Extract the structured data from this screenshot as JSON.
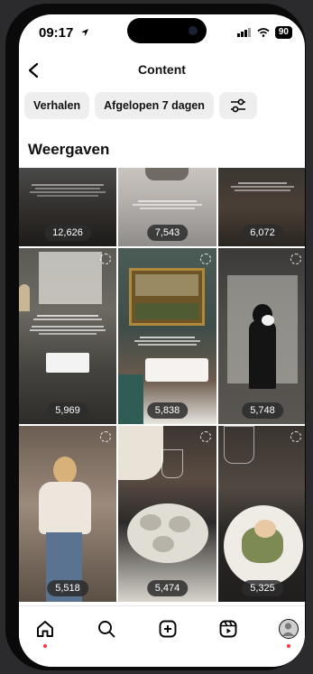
{
  "status_bar": {
    "time": "09:17",
    "battery": "90"
  },
  "header": {
    "title": "Content"
  },
  "filters": {
    "content_type": "Verhalen",
    "period": "Afgelopen 7 dagen"
  },
  "section": {
    "title": "Weergaven"
  },
  "tiles": [
    {
      "views": "12,626"
    },
    {
      "views": "7,543"
    },
    {
      "views": "6,072"
    },
    {
      "views": "5,969"
    },
    {
      "views": "5,838"
    },
    {
      "views": "5,748"
    },
    {
      "views": "5,518"
    },
    {
      "views": "5,474"
    },
    {
      "views": "5,325"
    }
  ],
  "nav": {
    "icons": [
      "home-icon",
      "search-icon",
      "create-icon",
      "reels-icon",
      "profile-avatar"
    ]
  }
}
